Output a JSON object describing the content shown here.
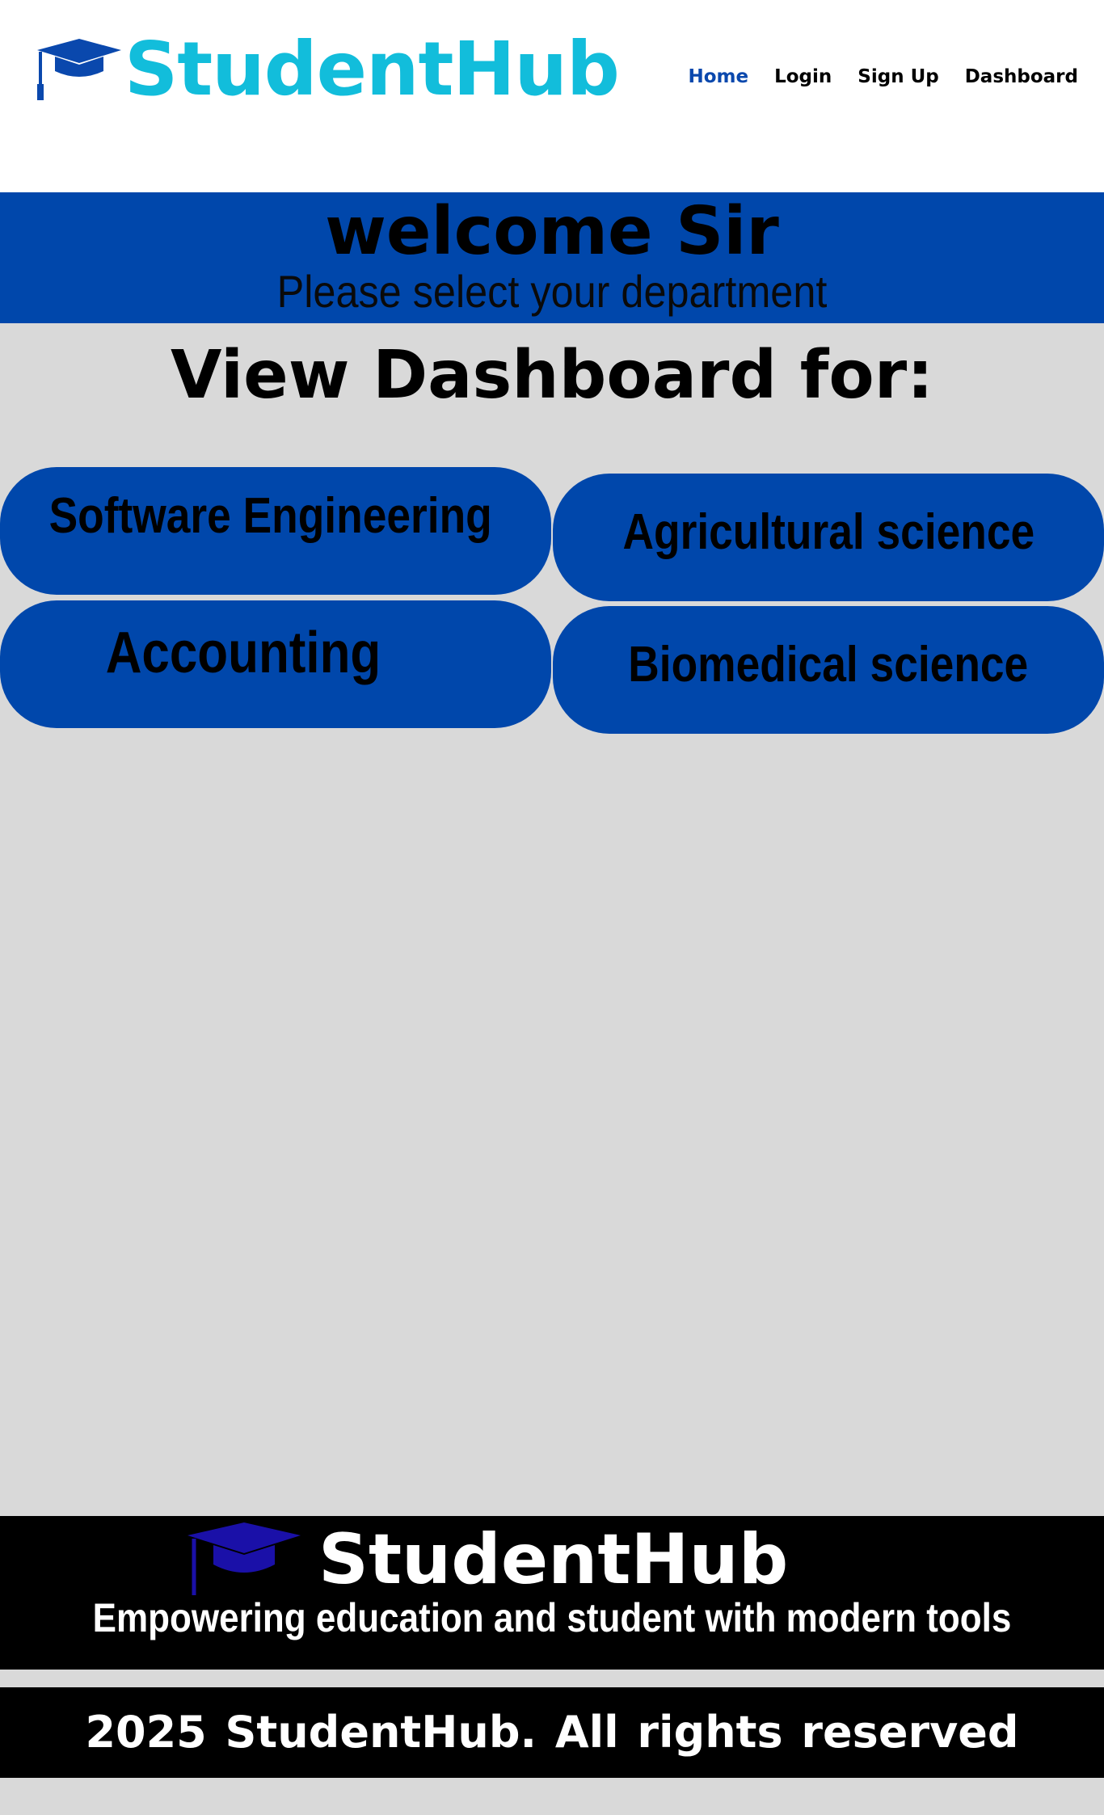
{
  "header": {
    "brand": "StudentHub",
    "logo_icon": "graduation-cap-icon",
    "logo_color": "#12bddb",
    "nav": [
      {
        "label": "Home",
        "active": true
      },
      {
        "label": "Login",
        "active": false
      },
      {
        "label": "Sign Up",
        "active": false
      },
      {
        "label": "Dashboard",
        "active": false
      }
    ]
  },
  "banner": {
    "title": "welcome Sir",
    "subtitle": "Please select your department",
    "color": "#0047ab"
  },
  "main": {
    "heading": "View Dashboard for:",
    "departments": [
      {
        "label": "Software Engineering"
      },
      {
        "label": "Agricultural science"
      },
      {
        "label": "Accounting"
      },
      {
        "label": "Biomedical science"
      }
    ]
  },
  "footer": {
    "brand": "StudentHub",
    "logo_icon": "graduation-cap-icon",
    "tagline": "Empowering education and student with modern tools",
    "copyright": "2025  StudentHub. All rights reserved"
  }
}
